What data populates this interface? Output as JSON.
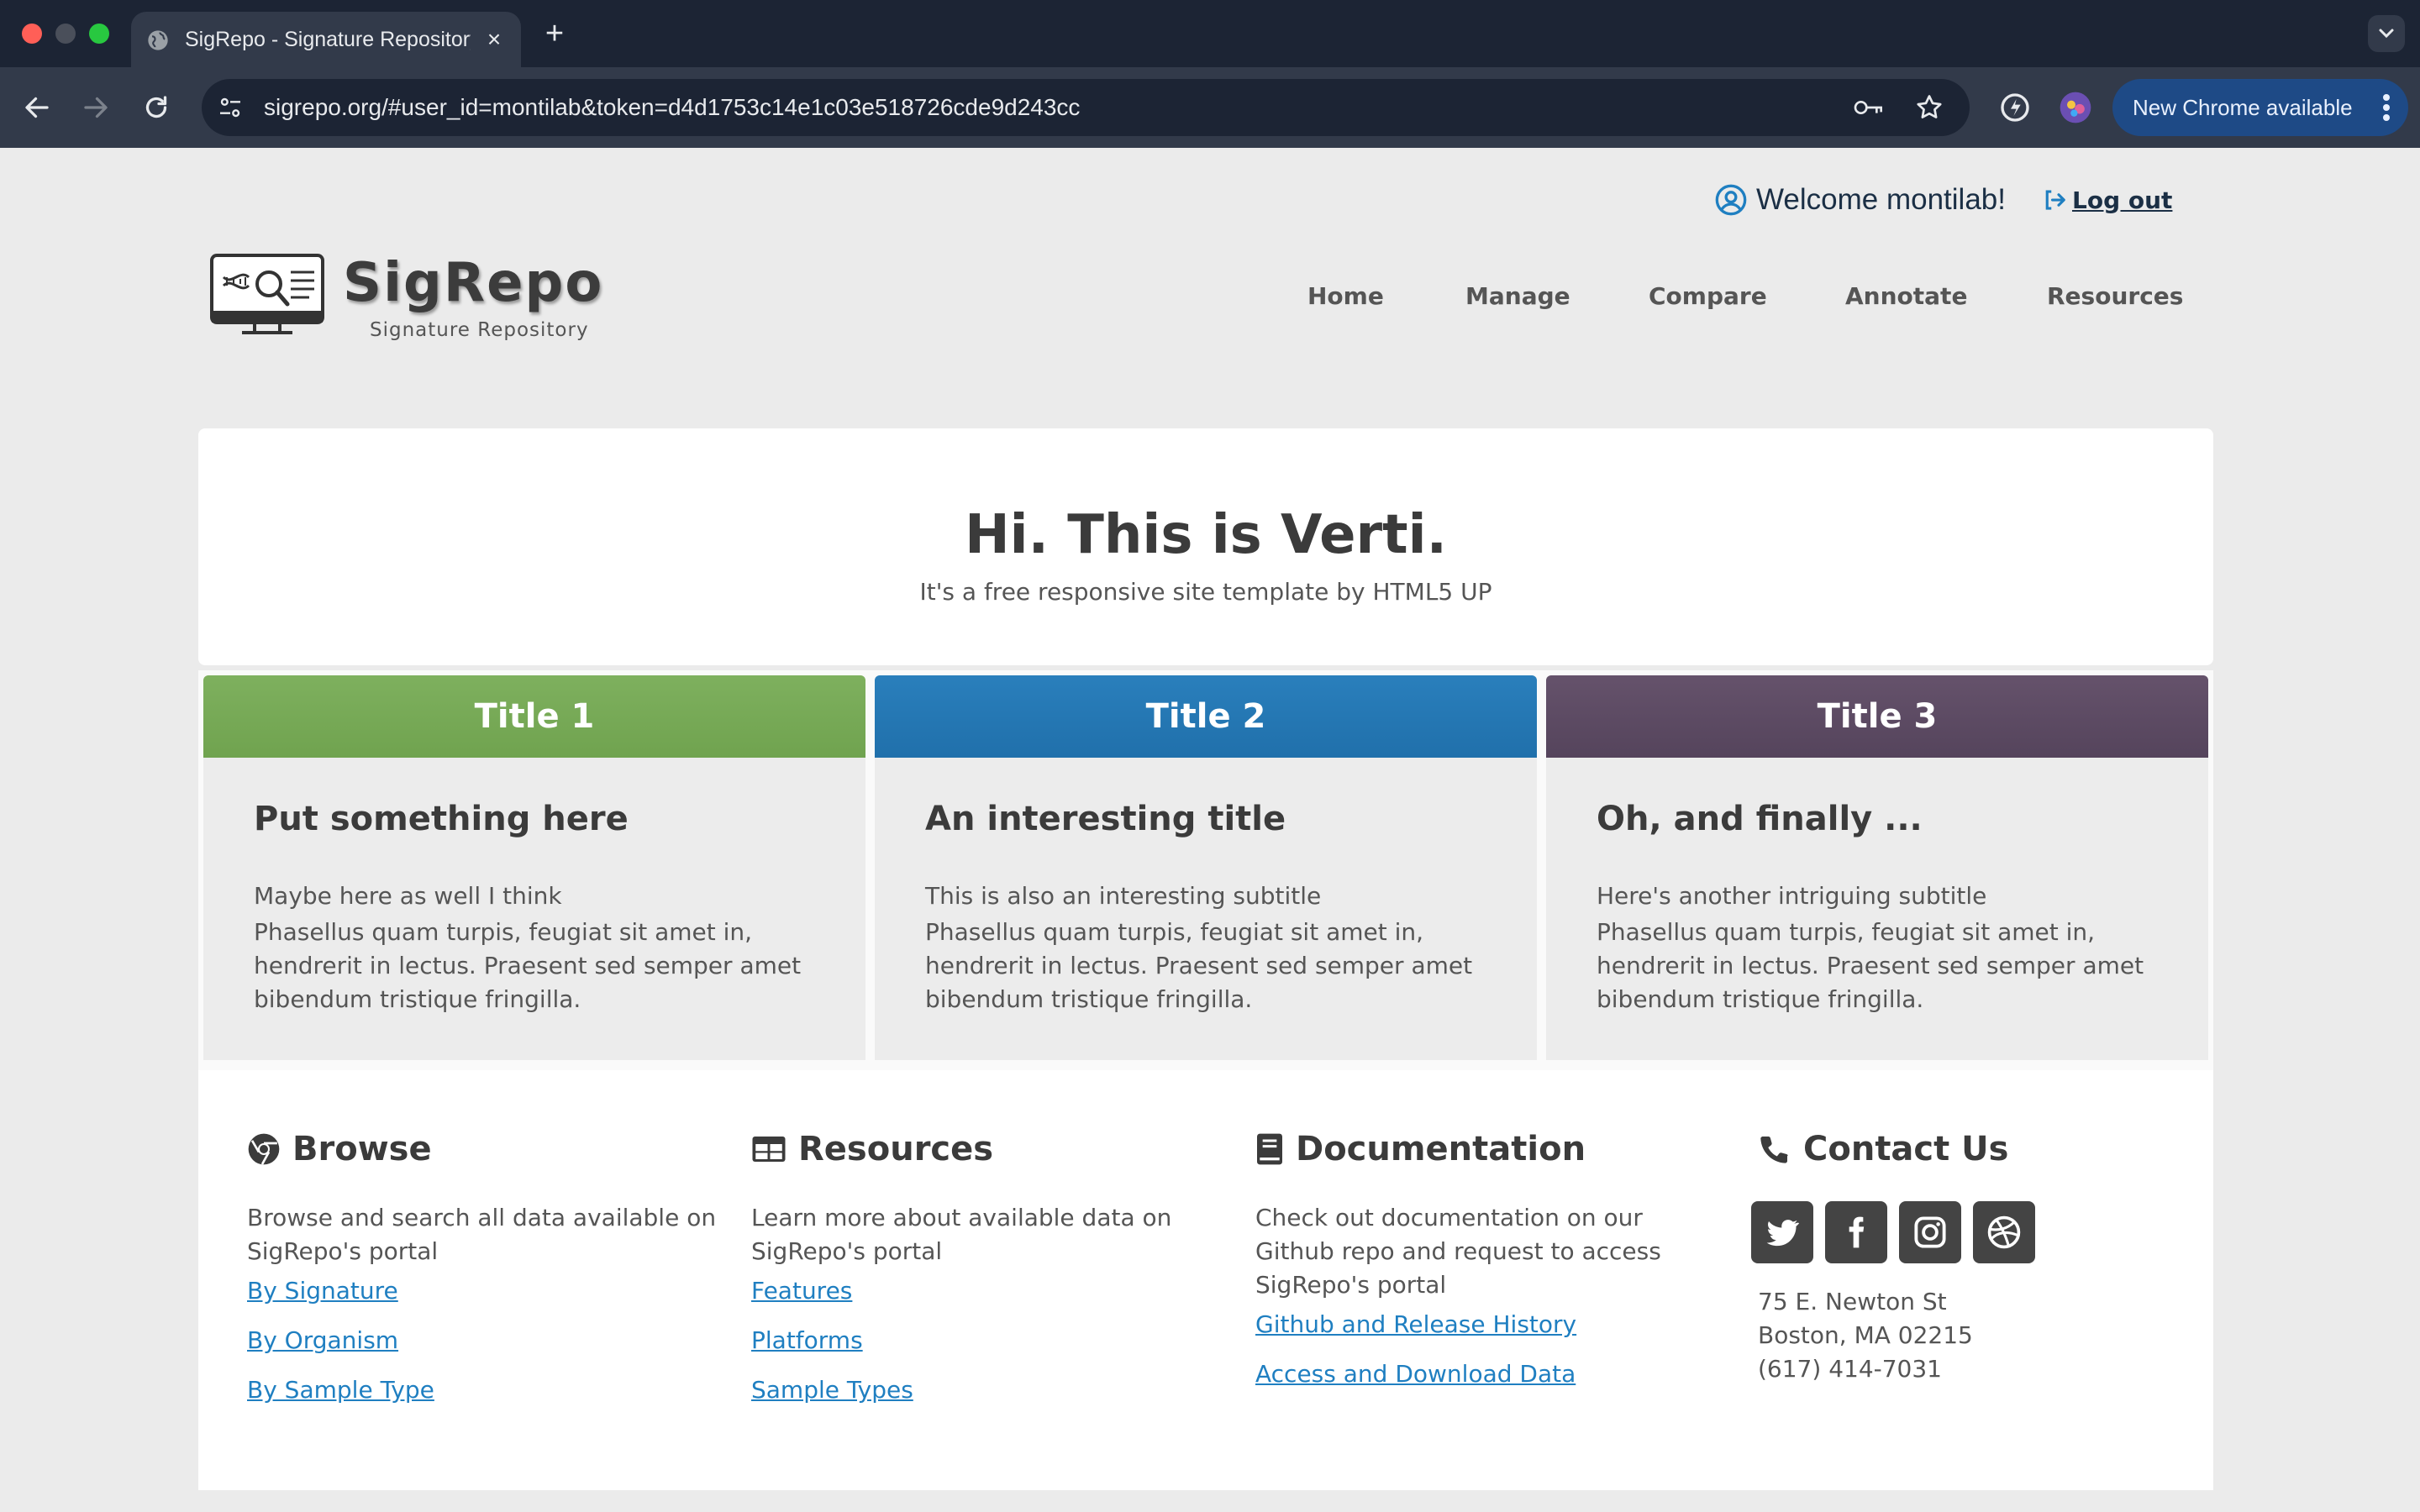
{
  "browser": {
    "tab_title": "SigRepo - Signature Repository",
    "new_tab_symbol": "+",
    "close_symbol": "×",
    "url": "sigrepo.org/#user_id=montilab&token=d4d1753c14e1c03e518726cde9d243cc",
    "update_label": "New Chrome available"
  },
  "header": {
    "welcome": "Welcome montilab!",
    "logout": "Log out",
    "logo_name": "SigRepo",
    "logo_subtitle": "Signature Repository"
  },
  "nav": {
    "items": [
      {
        "label": "Home"
      },
      {
        "label": "Manage"
      },
      {
        "label": "Compare"
      },
      {
        "label": "Annotate"
      },
      {
        "label": "Resources"
      }
    ]
  },
  "banner": {
    "title": "Hi. This is Verti.",
    "subtitle": "It's a free responsive site template by HTML5 UP"
  },
  "features": [
    {
      "header": "Title 1",
      "color": "#74a852",
      "title": "Put something here",
      "subtitle": "Maybe here as well I think",
      "body": "Phasellus quam turpis, feugiat sit amet in, hendrerit in lectus. Praesent sed semper amet bibendum tristique fringilla."
    },
    {
      "header": "Title 2",
      "color": "#2476b2",
      "title": "An interesting title",
      "subtitle": "This is also an interesting subtitle",
      "body": "Phasellus quam turpis, feugiat sit amet in, hendrerit in lectus. Praesent sed semper amet bibendum tristique fringilla."
    },
    {
      "header": "Title 3",
      "color": "#5c4a62",
      "title": "Oh, and finally ...",
      "subtitle": "Here's another intriguing subtitle",
      "body": "Phasellus quam turpis, feugiat sit amet in, hendrerit in lectus. Praesent sed semper amet bibendum tristique fringilla."
    }
  ],
  "footer": {
    "browse": {
      "title": "Browse",
      "icon": "chrome-icon",
      "description": "Browse and search all data available on SigRepo's portal",
      "links": [
        "By Signature",
        "By Organism",
        "By Sample Type"
      ]
    },
    "resources": {
      "title": "Resources",
      "icon": "table-icon",
      "description": "Learn more about available data on SigRepo's portal",
      "links": [
        "Features",
        "Platforms",
        "Sample Types"
      ]
    },
    "documentation": {
      "title": "Documentation",
      "icon": "book-icon",
      "description": "Check out documentation on our Github repo and request to access SigRepo's portal",
      "links": [
        "Github and Release History",
        "Access and Download Data"
      ]
    },
    "contact": {
      "title": "Contact Us",
      "icon": "phone-icon",
      "socials": [
        "twitter-icon",
        "facebook-icon",
        "instagram-icon",
        "dribbble-icon"
      ],
      "address_line1": "75 E. Newton St",
      "address_line2": "Boston, MA 02215",
      "phone": "(617) 414-7031"
    }
  },
  "colors": {
    "link": "#1f7fc1",
    "chrome_dark": "#1c2434",
    "chrome_toolbar": "#323a4a",
    "update_button": "#1e4a86"
  }
}
